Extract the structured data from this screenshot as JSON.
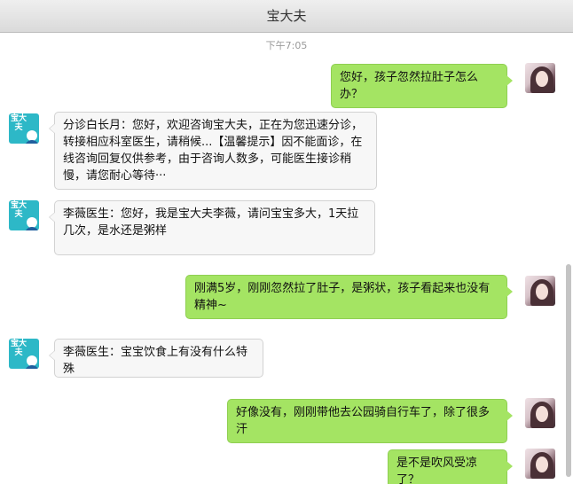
{
  "window": {
    "title": "宝大夫"
  },
  "chat": {
    "timestamp": "下午7:05",
    "messages": [
      {
        "sender": "user",
        "text": "您好，孩子忽然拉肚子怎么办？"
      },
      {
        "sender": "doctor",
        "text": "分诊白长月：您好，欢迎咨询宝大夫，正在为您迅速分诊，转接相应科室医生，请稍候...【温馨提示】因不能面诊，在线咨询回复仅供参考，由于咨询人数多，可能医生接诊稍慢，请您耐心等待···"
      },
      {
        "sender": "doctor",
        "text": "李薇医生：您好，我是宝大夫李薇，请问宝宝多大，1天拉几次，是水还是粥样"
      },
      {
        "sender": "user",
        "text": "刚满5岁，刚刚忽然拉了肚子，是粥状，孩子看起来也没有精神~"
      },
      {
        "sender": "doctor",
        "text": "李薇医生：宝宝饮食上有没有什么特殊"
      },
      {
        "sender": "user",
        "text": "好像没有，刚刚带他去公园骑自行车了，除了很多汗"
      },
      {
        "sender": "user",
        "text": "是不是吹风受凉了？"
      }
    ],
    "doctor_avatar_text": "宝大夫"
  },
  "colors": {
    "user_bubble": "#a4e463",
    "doctor_bubble": "#f7f7f7",
    "doctor_avatar_bg": "#2db8c7"
  }
}
